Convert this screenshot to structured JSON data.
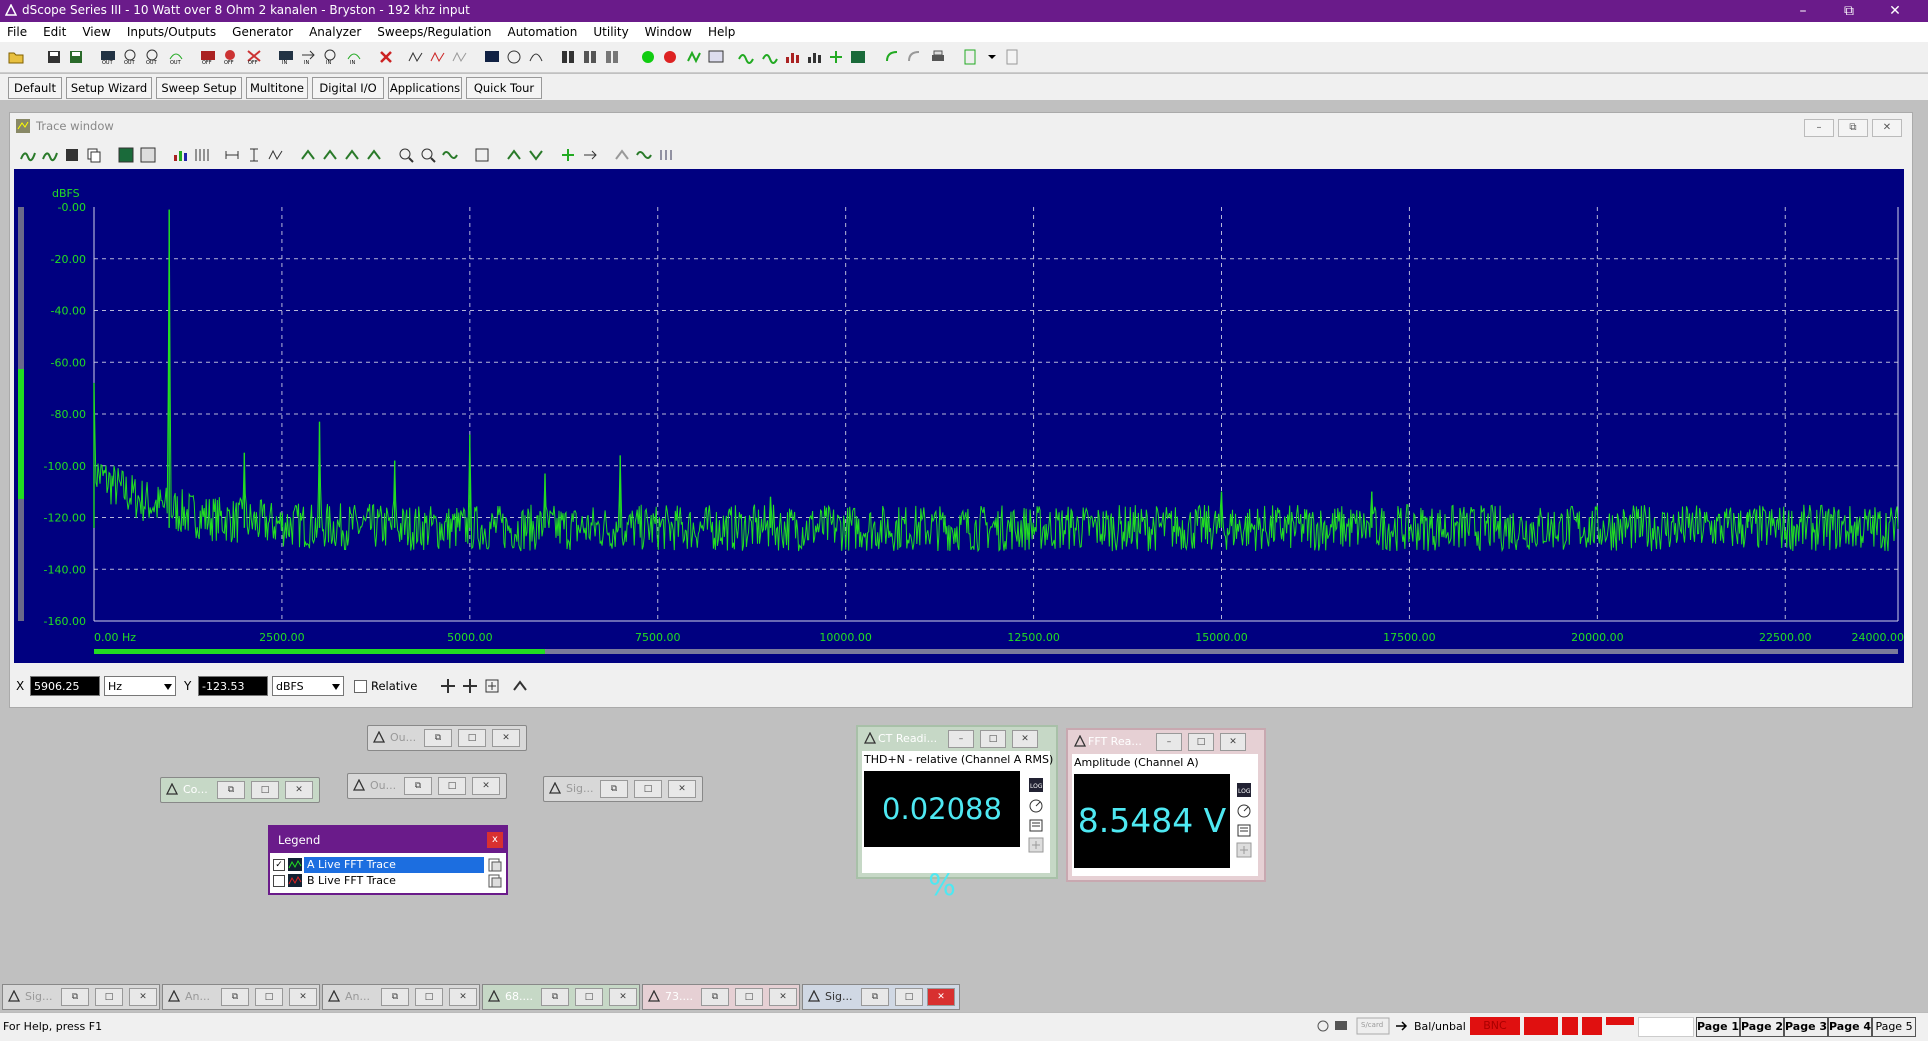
{
  "app": {
    "title": "dScope Series III - 10 Watt over 8 Ohm 2 kanalen - Bryston - 192 khz input"
  },
  "menu": [
    "File",
    "Edit",
    "View",
    "Inputs/Outputs",
    "Generator",
    "Analyzer",
    "Sweeps/Regulation",
    "Automation",
    "Utility",
    "Window",
    "Help"
  ],
  "toolbar2": {
    "buttons": [
      "Default",
      "Setup Wizard",
      "Sweep Setup",
      "Multitone",
      "Digital I/O",
      "Applications",
      "Quick Tour"
    ]
  },
  "trace_window": {
    "title": "Trace window"
  },
  "chart_data": {
    "type": "line",
    "title": "",
    "ylabel": "dBFS",
    "xlabel": "",
    "xlim": [
      0,
      24000
    ],
    "ylim": [
      -160,
      0
    ],
    "x_ticks": [
      "0.00 Hz",
      "2500.00",
      "5000.00",
      "7500.00",
      "10000.00",
      "12500.00",
      "15000.00",
      "17500.00",
      "20000.00",
      "22500.00",
      "24000.00"
    ],
    "y_ticks": [
      "-0.00",
      "-20.00",
      "-40.00",
      "-60.00",
      "-80.00",
      "-100.00",
      "-120.00",
      "-140.00",
      "-160.00"
    ],
    "grid": true,
    "series": [
      {
        "name": "A Live FFT Trace",
        "color": "#22dd22",
        "noise_floor_dbfs": -124,
        "peaks": [
          {
            "x": 0,
            "y": -68
          },
          {
            "x": 1000,
            "y": -1
          },
          {
            "x": 2000,
            "y": -95
          },
          {
            "x": 3000,
            "y": -83
          },
          {
            "x": 4000,
            "y": -98
          },
          {
            "x": 5000,
            "y": -88
          },
          {
            "x": 6000,
            "y": -103
          },
          {
            "x": 7000,
            "y": -96
          },
          {
            "x": 9000,
            "y": -112
          },
          {
            "x": 13000,
            "y": -117
          },
          {
            "x": 15000,
            "y": -110
          },
          {
            "x": 17000,
            "y": -110
          },
          {
            "x": 22000,
            "y": -118
          }
        ]
      }
    ]
  },
  "cursor": {
    "x_label": "X",
    "x_value": "5906.25",
    "x_unit": "Hz",
    "y_label": "Y",
    "y_value": "-123.53",
    "y_unit": "dBFS",
    "relative_label": "Relative"
  },
  "mini_windows": {
    "ou1": "Ou...",
    "co": "Co...",
    "ou2": "Ou...",
    "sig": "Sig..."
  },
  "legend": {
    "title": "Legend",
    "close": "x",
    "items": [
      {
        "label": "A  Live FFT Trace",
        "checked": true
      },
      {
        "label": "B  Live FFT Trace",
        "checked": false
      }
    ]
  },
  "thd_reading": {
    "title": "CT Readi...",
    "caption": "THD+N - relative (Channel A RMS)",
    "value": "0.02088 %"
  },
  "fft_reading": {
    "title": "FFT Rea...",
    "caption": "Amplitude (Channel A)",
    "value": "8.5484 V"
  },
  "taskbar": [
    "Sig...",
    "An...",
    "An...",
    "68....",
    "73....",
    "Sig..."
  ],
  "status": {
    "help": "For Help, press F1",
    "balunbal": "Bal/unbal",
    "bnc": "BNC",
    "pages": [
      "Page 1",
      "Page 2",
      "Page 3",
      "Page 4",
      "Page 5"
    ]
  }
}
